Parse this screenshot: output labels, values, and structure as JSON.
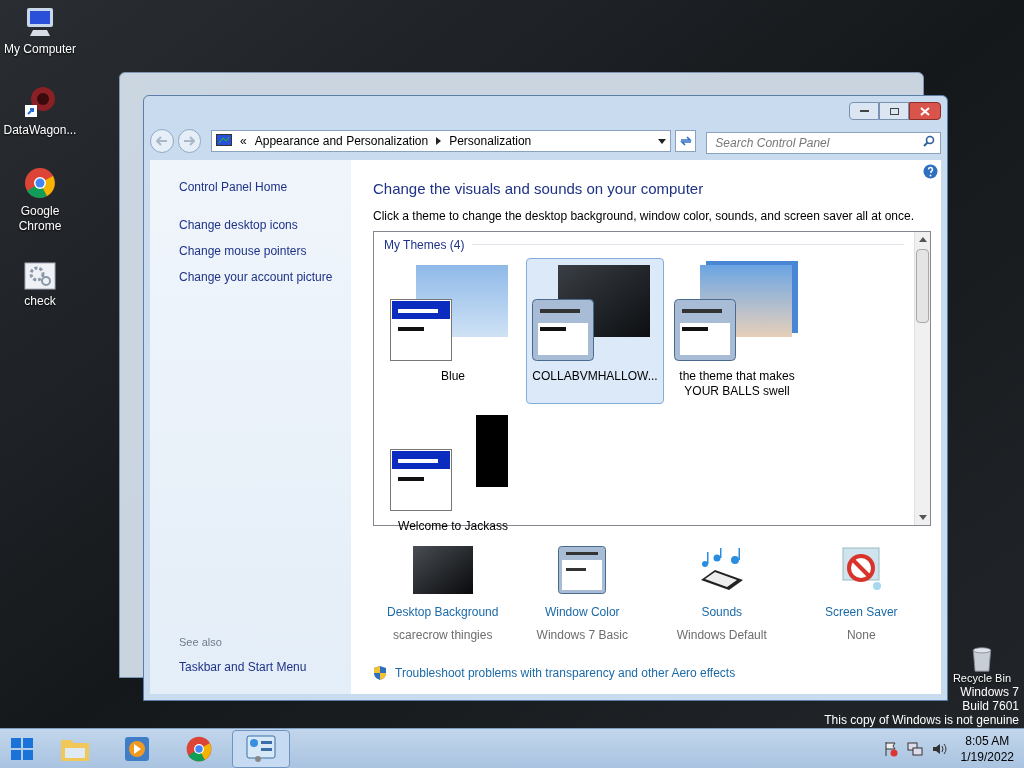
{
  "desktop_icons": [
    {
      "label": "My Computer",
      "kind": "computer"
    },
    {
      "label": "DataWagon...",
      "kind": "shortcut"
    },
    {
      "label": "Google Chrome",
      "kind": "chrome"
    },
    {
      "label": "check",
      "kind": "gear"
    }
  ],
  "recycle_bin": {
    "label": "Recycle Bin"
  },
  "window": {
    "address": {
      "overflow": "«",
      "crumbs": [
        "Appearance and Personalization",
        "Personalization"
      ]
    },
    "search": {
      "placeholder": "Search Control Panel"
    },
    "sidebar": {
      "home": "Control Panel Home",
      "tasks": [
        "Change desktop icons",
        "Change mouse pointers",
        "Change your account picture"
      ],
      "see_also_heading": "See also",
      "see_also": [
        "Taskbar and Start Menu"
      ]
    },
    "title": "Change the visuals and sounds on your computer",
    "subtitle": "Click a theme to change the desktop background, window color, sounds, and screen saver all at once.",
    "themes_heading": "My Themes (4)",
    "themes": [
      {
        "label": "Blue",
        "kind": "blue",
        "selected": false
      },
      {
        "label": "COLLABVMHALLOW...",
        "kind": "basic",
        "selected": true
      },
      {
        "label": "the theme that makes YOUR BALLS swell",
        "kind": "basic",
        "selected": false
      },
      {
        "label": "Welcome to Jackass",
        "kind": "blue",
        "selected": false
      }
    ],
    "settings": [
      {
        "label": "Desktop Background",
        "value": "scarecrow thingies",
        "kind": "background"
      },
      {
        "label": "Window Color",
        "value": "Windows 7 Basic",
        "kind": "color"
      },
      {
        "label": "Sounds",
        "value": "Windows Default",
        "kind": "sounds"
      },
      {
        "label": "Screen Saver",
        "value": "None",
        "kind": "saver"
      }
    ],
    "troubleshoot_link": "Troubleshoot problems with transparency and other Aero effects"
  },
  "taskbar": {
    "items": [
      {
        "kind": "explorer",
        "selected": false
      },
      {
        "kind": "media",
        "selected": false
      },
      {
        "kind": "chrome",
        "selected": false
      },
      {
        "kind": "control",
        "selected": true
      }
    ],
    "time": "8:05 AM",
    "date": "1/19/2022"
  },
  "genuine_notice": [
    "Windows 7",
    "Build 7601",
    "This copy of Windows is not genuine"
  ]
}
